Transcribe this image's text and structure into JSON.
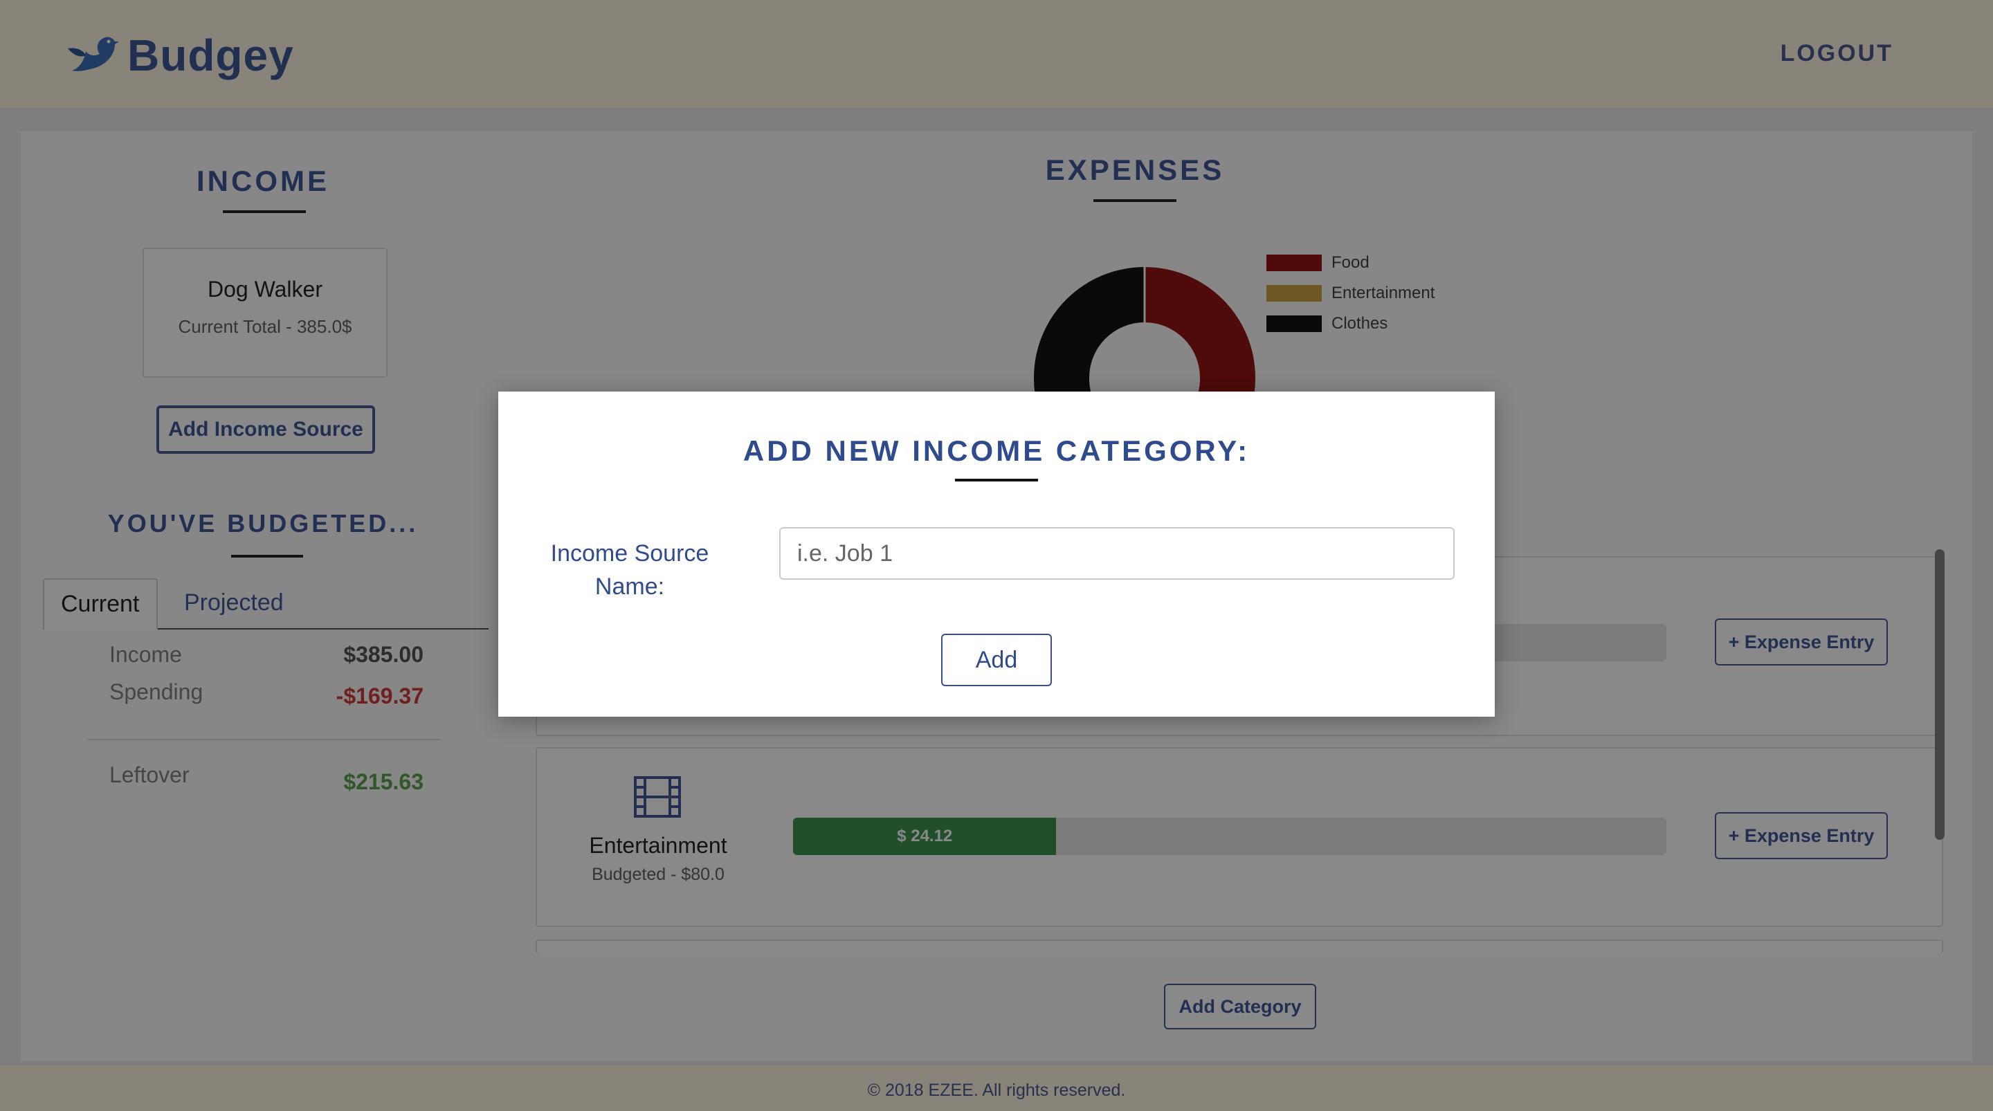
{
  "app": {
    "brand": "Budgey",
    "logout_label": "LOGOUT"
  },
  "income": {
    "title": "INCOME",
    "sources": [
      {
        "name": "Dog Walker",
        "total": "Current Total - 385.0$"
      }
    ],
    "add_button_label": "Add Income Source"
  },
  "budget": {
    "title": "YOU'VE BUDGETED...",
    "tabs": [
      "Current",
      "Projected"
    ],
    "active_tab": "Current",
    "income_label": "Income",
    "income_value": "$385.00",
    "spending_label": "Spending",
    "spending_value": "-$169.37",
    "leftover_label": "Leftover",
    "leftover_value": "$215.63",
    "colors": {
      "negative": "#cc2b2b",
      "positive": "#4c9a3c"
    }
  },
  "expenses": {
    "title": "EXPENSES",
    "categories": [
      {
        "name": "Entertainment",
        "budgeted": "Budgeted - $80.0",
        "spent_label": "$ 24.12",
        "spent_value": 24.12,
        "budget_value": 80.0,
        "icon": "film-icon",
        "add_entry_label": "+ Expense Entry"
      }
    ],
    "first_panel_add_entry_label": "+ Expense Entry",
    "add_category_label": "Add Category"
  },
  "chart_data": {
    "type": "pie",
    "categories": [
      "Food",
      "Entertainment",
      "Clothes"
    ],
    "colors": [
      "#8b0000",
      "#c49a37",
      "#000000"
    ],
    "legend_position": "right"
  },
  "modal": {
    "title": "ADD NEW INCOME CATEGORY:",
    "field_label": "Income Source Name:",
    "input_placeholder": "i.e. Job 1",
    "input_value": "",
    "add_button_label": "Add"
  },
  "footer": {
    "text": "© 2018 EZEE. All rights reserved."
  }
}
